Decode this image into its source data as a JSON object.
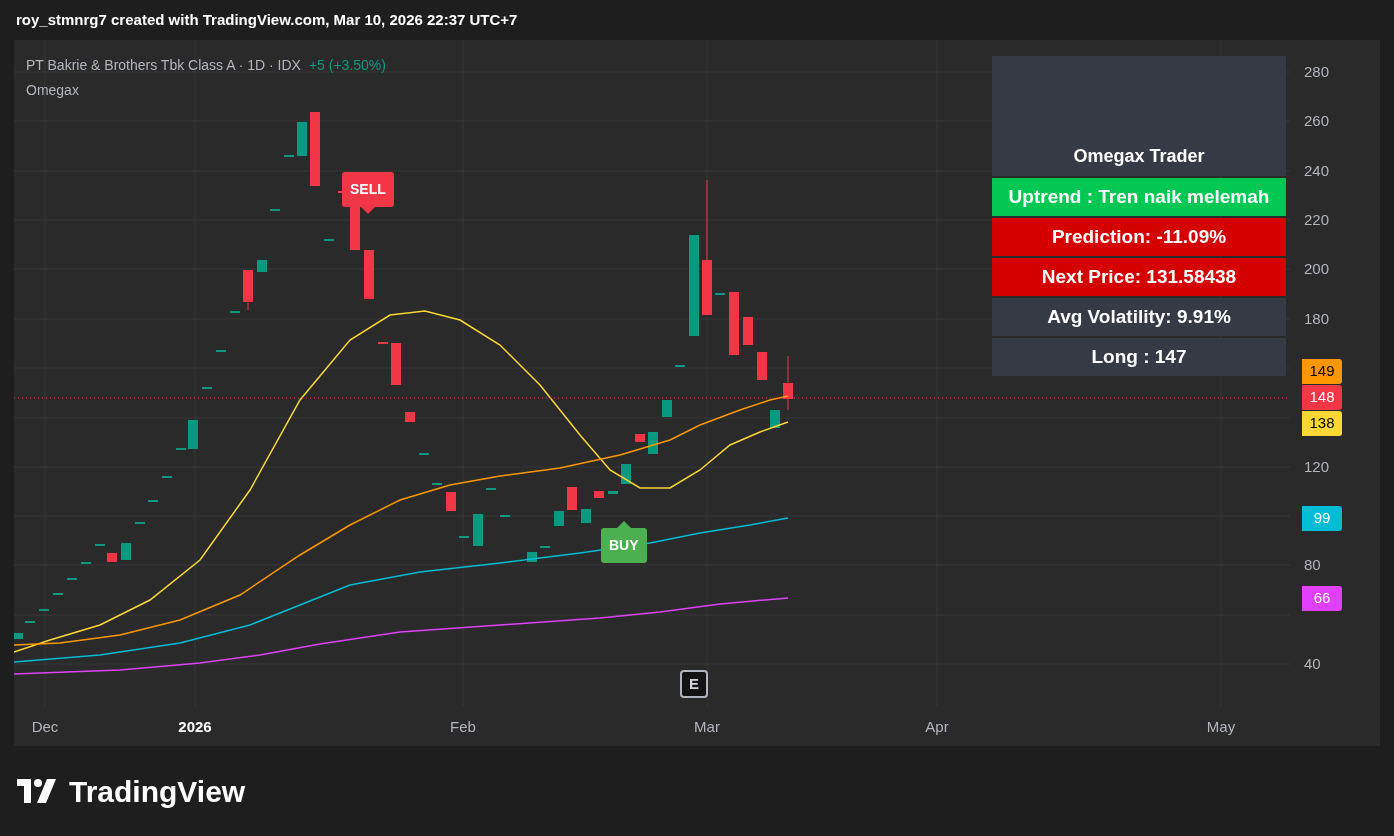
{
  "attribution": "roy_stmnrg7 created with TradingView.com, Mar 10, 2026 22:37 UTC+7",
  "legend": {
    "symbol": "PT Bakrie & Brothers Tbk Class A · 1D · IDX",
    "change": "+5 (+3.50%)",
    "indicator": "Omegax"
  },
  "signals": [
    {
      "kind": "sell",
      "label": "SELL"
    },
    {
      "kind": "buy",
      "label": "BUY"
    }
  ],
  "info_table": {
    "title": "Omegax Trader",
    "rows": [
      {
        "text": "Uptrend : Tren naik melemah",
        "color": "#00c853"
      },
      {
        "text": "Prediction: -11.09%",
        "color": "#d50000"
      },
      {
        "text": "Next Price: 131.58438",
        "color": "#d50000"
      },
      {
        "text": "Avg Volatility: 9.91%",
        "color": "#363a45"
      },
      {
        "text": "Long : 147",
        "color": "#363a45"
      }
    ]
  },
  "price_axis": {
    "ticks": [
      "280",
      "260",
      "240",
      "220",
      "200",
      "180",
      "120",
      "80",
      "40"
    ],
    "tags": [
      {
        "value": "149",
        "color": "#ff9800"
      },
      {
        "value": "148",
        "color": "#f23645"
      },
      {
        "value": "138",
        "color": "#fdd835"
      },
      {
        "value": "99",
        "color": "#00bcd4"
      },
      {
        "value": "66",
        "color": "#e040fb"
      }
    ]
  },
  "event_marker": "E",
  "time_axis": [
    {
      "label": "Dec",
      "kind": "month"
    },
    {
      "label": "2026",
      "kind": "year"
    },
    {
      "label": "Feb",
      "kind": "month"
    },
    {
      "label": "Mar",
      "kind": "month"
    },
    {
      "label": "Apr",
      "kind": "month"
    },
    {
      "label": "May",
      "kind": "month"
    }
  ],
  "logo": "TradingView"
}
